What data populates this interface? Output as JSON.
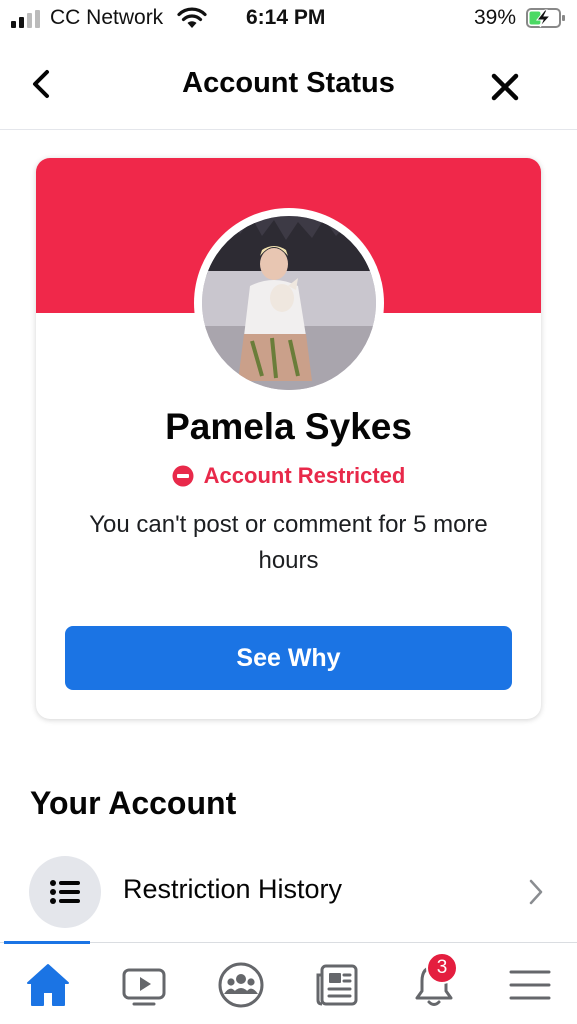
{
  "status_bar": {
    "carrier": "CC Network",
    "time": "6:14 PM",
    "battery_percent": "39%",
    "battery_level": 0.39,
    "signal_icon": "cellular-signal-icon",
    "wifi_icon": "wifi-icon",
    "battery_icon": "battery-charging-icon"
  },
  "header": {
    "title": "Account Status",
    "back_icon": "chevron-left-icon",
    "close_icon": "close-icon"
  },
  "card": {
    "banner_color": "#f0284a",
    "avatar_icon": "profile-photo",
    "user_name": "Pamela Sykes",
    "status_icon": "no-entry-icon",
    "status_label": "Account Restricted",
    "status_color": "#e8294a",
    "message": "You can't post or comment for 5 more hours",
    "button_label": "See Why",
    "button_color": "#1b74e4"
  },
  "your_account": {
    "title": "Your Account",
    "items": [
      {
        "label": "Restriction History",
        "icon": "list-icon",
        "chevron": "chevron-right-icon"
      }
    ]
  },
  "tab_bar": {
    "active_tab": "home",
    "tabs": [
      {
        "name": "home",
        "icon": "home-icon"
      },
      {
        "name": "watch",
        "icon": "video-icon"
      },
      {
        "name": "groups",
        "icon": "groups-icon"
      },
      {
        "name": "news",
        "icon": "news-feed-icon"
      },
      {
        "name": "notifications",
        "icon": "bell-icon",
        "badge": "3"
      },
      {
        "name": "menu",
        "icon": "menu-icon"
      }
    ]
  }
}
